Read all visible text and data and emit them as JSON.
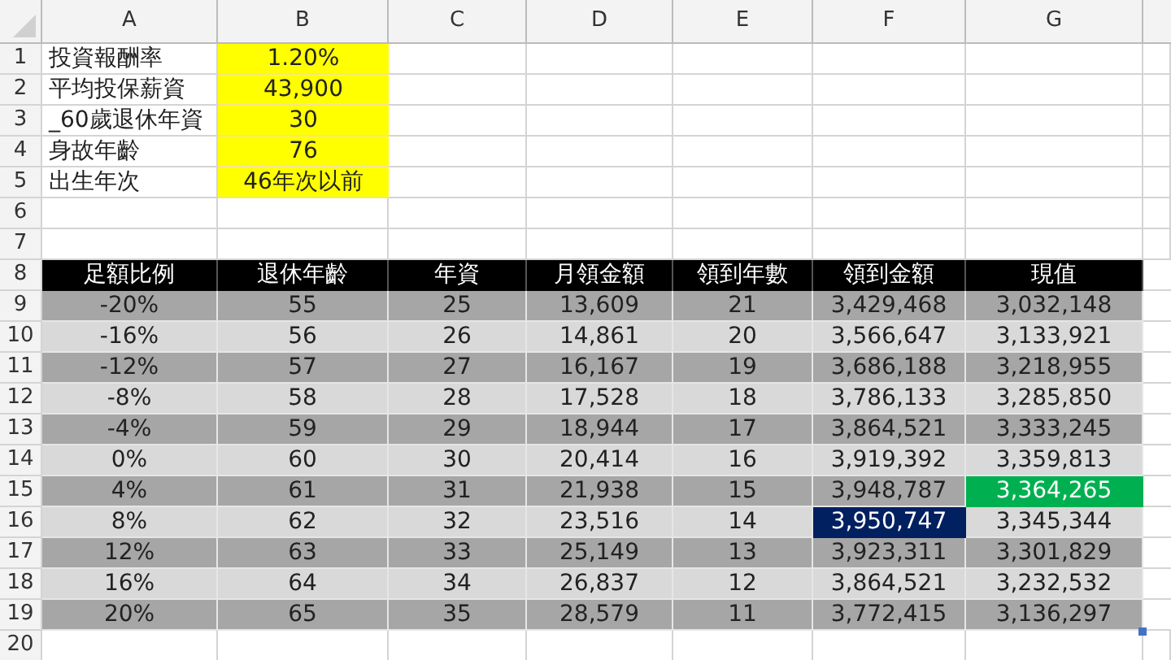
{
  "columns": [
    "A",
    "B",
    "C",
    "D",
    "E",
    "F",
    "G"
  ],
  "row_numbers": [
    "1",
    "2",
    "3",
    "4",
    "5",
    "6",
    "7",
    "8",
    "9",
    "10",
    "11",
    "12",
    "13",
    "14",
    "15",
    "16",
    "17",
    "18",
    "19",
    "20"
  ],
  "inputs": [
    {
      "label": "投資報酬率",
      "value": "1.20%"
    },
    {
      "label": "平均投保薪資",
      "value": "43,900"
    },
    {
      "label": "_60歲退休年資",
      "value": "30"
    },
    {
      "label": "身故年齡",
      "value": "76"
    },
    {
      "label": "出生年次",
      "value": "46年次以前"
    }
  ],
  "table": {
    "headers": [
      "足額比例",
      "退休年齡",
      "年資",
      "月領金額",
      "領到年數",
      "領到金額",
      "現值"
    ],
    "rows": [
      {
        "cells": [
          "-20%",
          "55",
          "25",
          "13,609",
          "21",
          "3,429,468",
          "3,032,148"
        ]
      },
      {
        "cells": [
          "-16%",
          "56",
          "26",
          "14,861",
          "20",
          "3,566,647",
          "3,133,921"
        ]
      },
      {
        "cells": [
          "-12%",
          "57",
          "27",
          "16,167",
          "19",
          "3,686,188",
          "3,218,955"
        ]
      },
      {
        "cells": [
          "-8%",
          "58",
          "28",
          "17,528",
          "18",
          "3,786,133",
          "3,285,850"
        ]
      },
      {
        "cells": [
          "-4%",
          "59",
          "29",
          "18,944",
          "17",
          "3,864,521",
          "3,333,245"
        ]
      },
      {
        "cells": [
          "0%",
          "60",
          "30",
          "20,414",
          "16",
          "3,919,392",
          "3,359,813"
        ]
      },
      {
        "cells": [
          "4%",
          "61",
          "31",
          "21,938",
          "15",
          "3,948,787",
          {
            "text": "3,364,265",
            "color": "#00b050"
          }
        ]
      },
      {
        "cells": [
          "8%",
          "62",
          "32",
          "23,516",
          "14",
          {
            "text": "3,950,747",
            "color": "#002060"
          },
          "3,345,344"
        ]
      },
      {
        "cells": [
          "12%",
          "63",
          "33",
          "25,149",
          "13",
          "3,923,311",
          "3,301,829"
        ]
      },
      {
        "cells": [
          "16%",
          "64",
          "34",
          "26,837",
          "12",
          "3,864,521",
          "3,232,532"
        ]
      },
      {
        "cells": [
          "20%",
          "65",
          "35",
          "28,579",
          "11",
          "3,772,415",
          "3,136,297"
        ]
      }
    ]
  }
}
